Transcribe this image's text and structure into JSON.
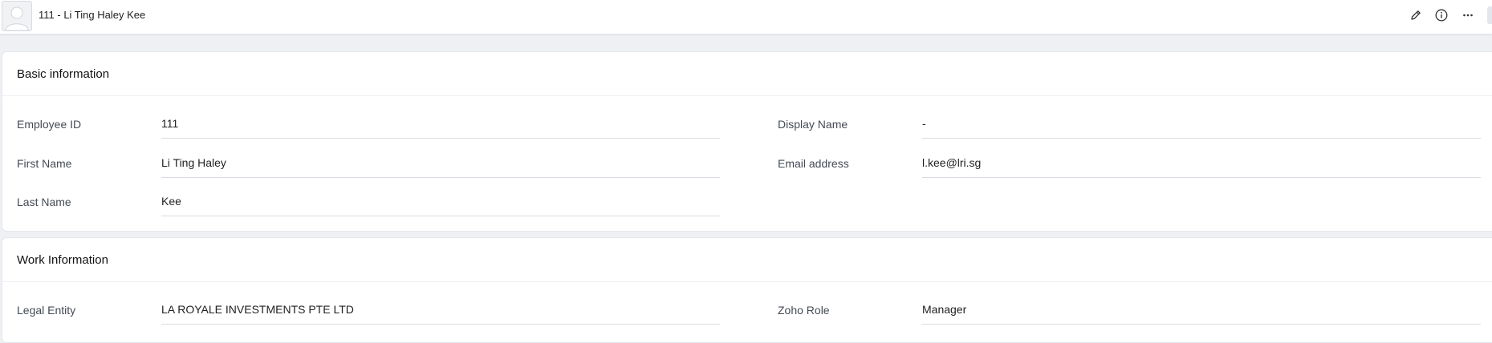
{
  "header": {
    "title": "111 - Li Ting Haley Kee",
    "icons": [
      "edit-icon",
      "info-icon",
      "more-icon"
    ]
  },
  "sections": {
    "basic": {
      "title": "Basic information",
      "fields": {
        "employee_id": {
          "label": "Employee ID",
          "value": "111"
        },
        "first_name": {
          "label": "First Name",
          "value": "Li Ting Haley"
        },
        "last_name": {
          "label": "Last Name",
          "value": "Kee"
        },
        "display_name": {
          "label": "Display Name",
          "value": "-"
        },
        "email": {
          "label": "Email address",
          "value": "l.kee@lri.sg"
        }
      }
    },
    "work": {
      "title": "Work Information",
      "fields": {
        "legal_entity": {
          "label": "Legal Entity",
          "value": "LA ROYALE INVESTMENTS PTE LTD"
        },
        "zoho_role": {
          "label": "Zoho Role",
          "value": "Manager"
        }
      }
    }
  },
  "colors": {
    "background": "#eef0f4",
    "card": "#ffffff",
    "divider": "#d9dde3"
  }
}
